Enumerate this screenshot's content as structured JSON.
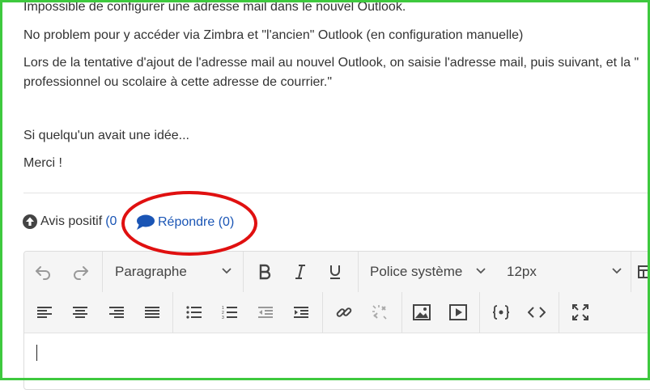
{
  "post": {
    "line1": "Impossible de configurer une adresse mail dans le nouvel Outlook.",
    "line2": "No problem pour y accéder via Zimbra et \"l'ancien\" Outlook (en configuration manuelle)",
    "line3": "Lors de la tentative d'ajout de l'adresse mail au nouvel Outlook, on saisie l'adresse mail, puis suivant, et la \"",
    "line4": "professionnel ou scolaire à cette adresse de courrier.\"",
    "line5": "Si quelqu'un avait une idée...",
    "line6": "Merci !"
  },
  "actions": {
    "kudo_label": "Avis positif",
    "kudo_count": "(0",
    "reply_label": "Répondre (0)"
  },
  "editor": {
    "paragraph_select": "Paragraphe",
    "font_select": "Police système",
    "size_select": "12px"
  },
  "colors": {
    "frame": "#3ec93e",
    "link": "#1a55b5",
    "annotation": "#e01010"
  }
}
